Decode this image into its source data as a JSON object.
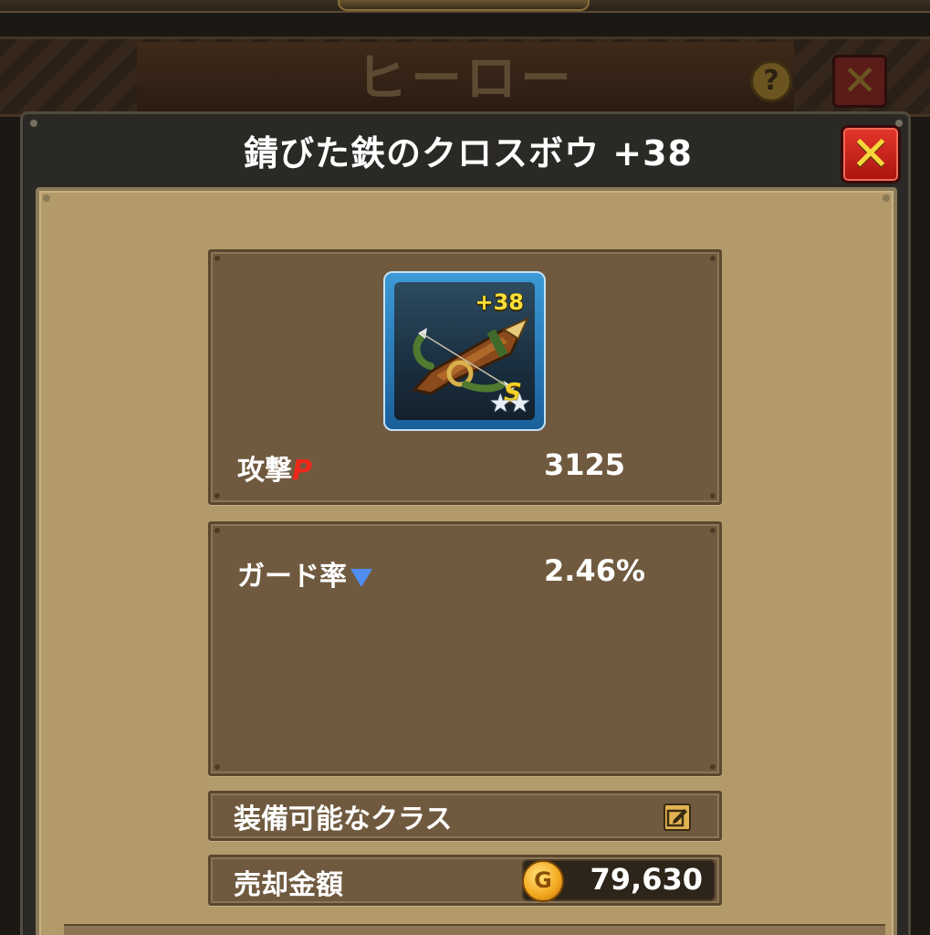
{
  "background": {
    "screen_title": "ヒーロー",
    "help_label": "?",
    "close_label": "✕"
  },
  "dialog": {
    "title": "錆びた鉄のクロスボウ +38",
    "close_label": "✕"
  },
  "item": {
    "icon": "crossbow-icon",
    "enhance_level": "+38",
    "rank": "S",
    "stars": 2,
    "stars_text": "★★"
  },
  "stats": {
    "attack_label": "攻撃",
    "attack_mark": "P",
    "attack_value": "3125",
    "guard_label": "ガード率",
    "guard_value": "2.46%"
  },
  "equip_class": {
    "label": "装備可能なクラス",
    "icon": "edit-icon"
  },
  "sell": {
    "label": "売却金額",
    "coin_symbol": "G",
    "amount": "79,630"
  },
  "colors": {
    "panel": "#b39a6a",
    "inset_box": "#705a3f",
    "dialog_frame": "#2b2925",
    "close_red": "#d6281f",
    "gold": "#f5d22a",
    "down_arrow": "#4f8df0",
    "p_mark_red": "#f0281c"
  }
}
